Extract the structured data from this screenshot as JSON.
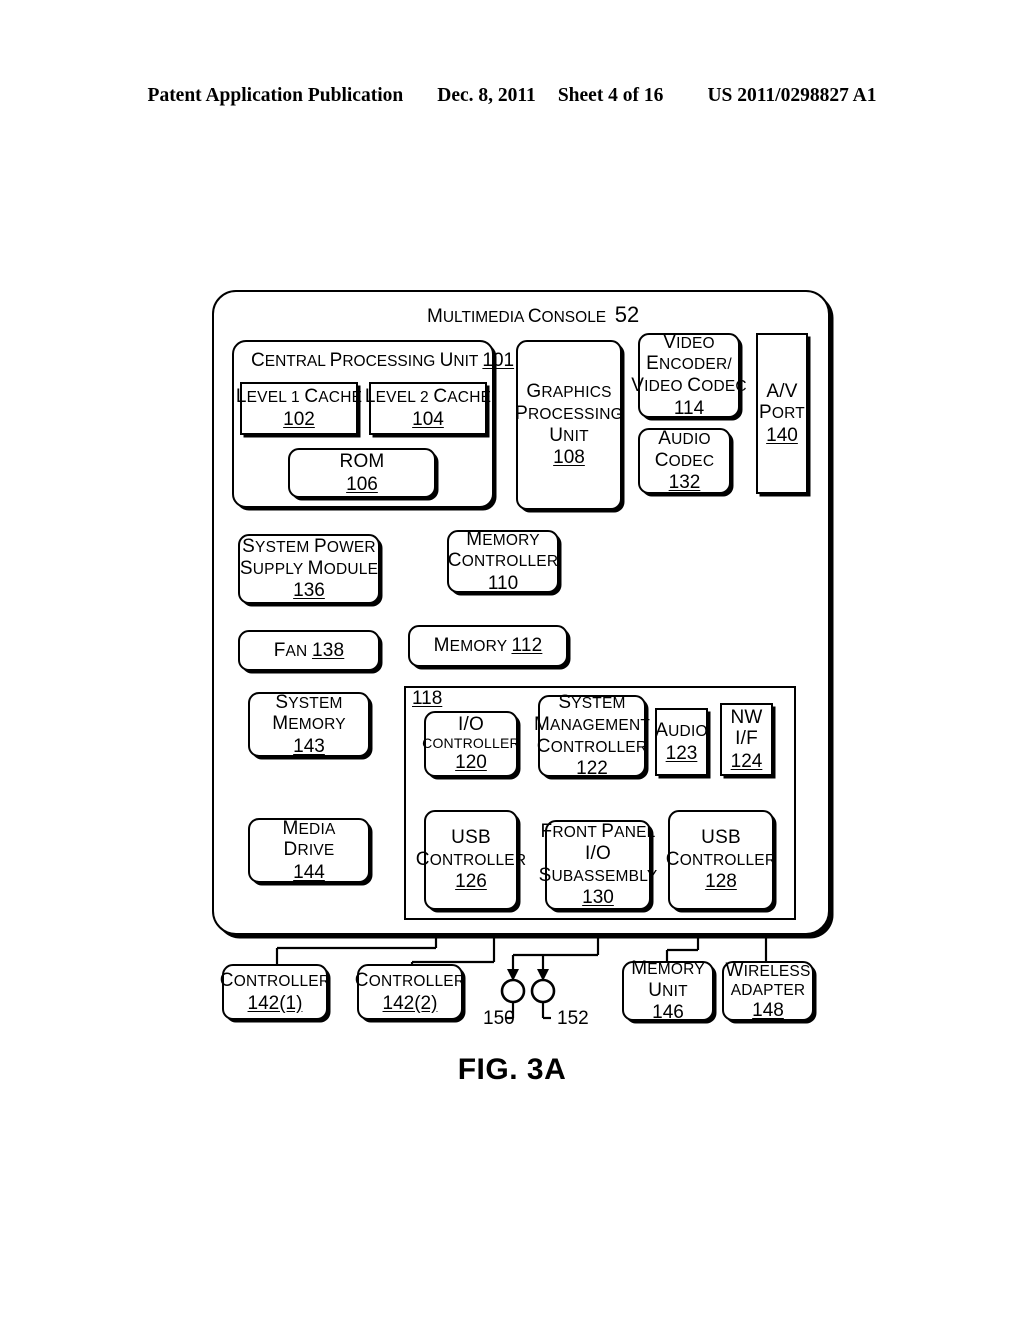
{
  "header": {
    "publication": "Patent Application Publication",
    "date": "Dec. 8, 2011",
    "sheet": "Sheet 4 of 16",
    "patent_number": "US 2011/0298827 A1"
  },
  "figure": {
    "caption": "FIG. 3A",
    "console_title": "Multimedia Console",
    "console_ref": "52"
  },
  "blocks": {
    "cpu": {
      "title": "Central Processing Unit",
      "ref": "101"
    },
    "l1_cache": {
      "line1": "Level 1 Cache",
      "ref": "102"
    },
    "l2_cache": {
      "line1": "Level 2 Cache",
      "ref": "104"
    },
    "rom": {
      "line1": "ROM",
      "ref": "106"
    },
    "gpu": {
      "line1": "Graphics",
      "line2": "Processing",
      "line3": "Unit",
      "ref": "108"
    },
    "video_encoder": {
      "line1": "Video",
      "line2": "Encoder/",
      "line3": "Video Codec",
      "ref": "114"
    },
    "audio_codec": {
      "line1": "Audio",
      "line2": "Codec",
      "ref": "132"
    },
    "av_port": {
      "line1": "A/V",
      "line2": "Port",
      "ref": "140"
    },
    "power_supply": {
      "line1": "System Power",
      "line2": "Supply Module",
      "ref": "136"
    },
    "fan": {
      "line1": "Fan",
      "ref": "138"
    },
    "memory_ctrl": {
      "line1": "Memory",
      "line2": "Controller",
      "ref": "110"
    },
    "memory": {
      "line1": "Memory",
      "ref": "112"
    },
    "system_memory": {
      "line1": "System",
      "line2": "Memory",
      "ref": "143"
    },
    "media_drive": {
      "line1": "Media",
      "line2": "Drive",
      "ref": "144"
    },
    "bus": {
      "ref": "118"
    },
    "io_ctrl": {
      "line1": "I/O",
      "line2": "Controller",
      "ref": "120"
    },
    "sys_mgmt_ctrl": {
      "line1": "System",
      "line2": "Management",
      "line3": "Controller",
      "ref": "122"
    },
    "audio": {
      "line1": "Audio",
      "ref": "123"
    },
    "nw_if": {
      "line1": "NW",
      "line2": "I/F",
      "ref": "124"
    },
    "usb_ctrl_1": {
      "line1": "USB",
      "line2": "Controller",
      "ref": "126"
    },
    "front_panel": {
      "line1": "Front Panel",
      "line2": "I/O",
      "line3": "Subassembly",
      "ref": "130"
    },
    "usb_ctrl_2": {
      "line1": "USB",
      "line2": "Controller",
      "ref": "128"
    },
    "controller_1": {
      "line1": "Controller",
      "ref": "142(1)"
    },
    "controller_2": {
      "line1": "Controller",
      "ref": "142(2)"
    },
    "memory_unit": {
      "line1": "Memory",
      "line2": "Unit",
      "ref": "146"
    },
    "wireless_adapter": {
      "line1": "Wireless",
      "line2": "Adapter",
      "ref": "148"
    }
  },
  "callouts": {
    "left_circle": "150",
    "right_circle": "152"
  }
}
